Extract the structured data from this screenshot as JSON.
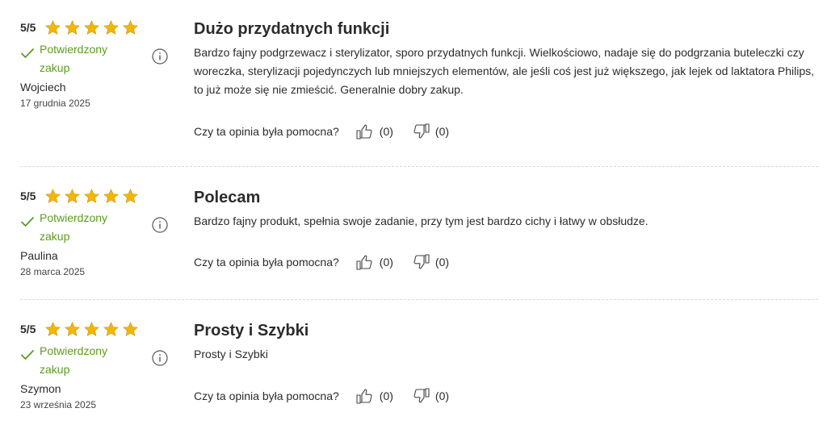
{
  "colors": {
    "accent_green": "#5d9b1f",
    "star": "#f2b705"
  },
  "icons": {
    "star": "star-icon",
    "check": "check-icon",
    "info": "info-icon",
    "up": "thumbs-up-icon",
    "down": "thumbs-down-icon"
  },
  "reviews": [
    {
      "score": "5/5",
      "stars": 5,
      "verified": "Potwierdzony zakup",
      "author": "Wojciech",
      "date": "17 grudnia 2025",
      "title": "Dużo przydatnych funkcji",
      "body": "Bardzo fajny podgrzewacz i sterylizator, sporo przydatnych funkcji. Wielkościowo, nadaje się do podgrzania buteleczki czy woreczka, sterylizacji pojedynczych lub mniejszych elementów, ale jeśli coś jest już większego, jak lejek od laktatora Philips, to już może się nie zmieścić. Generalnie dobry zakup.",
      "helpful_question": "Czy ta opinia była pomocna?",
      "up_count": "(0)",
      "down_count": "(0)"
    },
    {
      "score": "5/5",
      "stars": 5,
      "verified": "Potwierdzony zakup",
      "author": "Paulina",
      "date": "28 marca 2025",
      "title": "Polecam",
      "body": "Bardzo fajny produkt, spełnia swoje zadanie, przy tym jest bardzo cichy i łatwy w obsłudze.",
      "helpful_question": "Czy ta opinia była pomocna?",
      "up_count": "(0)",
      "down_count": "(0)"
    },
    {
      "score": "5/5",
      "stars": 5,
      "verified": "Potwierdzony zakup",
      "author": "Szymon",
      "date": "23 września 2025",
      "title": "Prosty i Szybki",
      "body": "Prosty i Szybki",
      "helpful_question": "Czy ta opinia była pomocna?",
      "up_count": "(0)",
      "down_count": "(0)"
    }
  ]
}
